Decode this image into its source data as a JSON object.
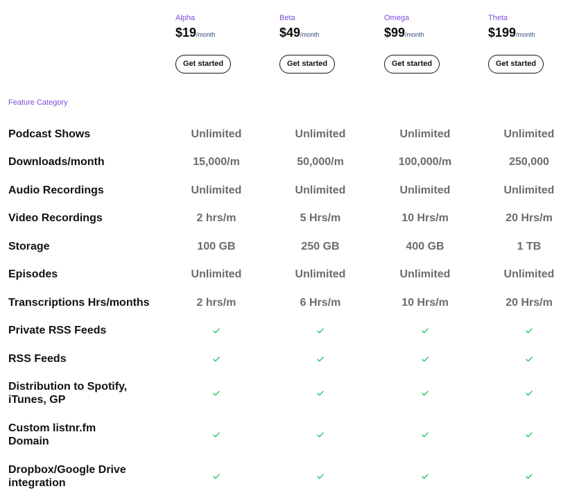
{
  "plans": [
    {
      "name": "Alpha",
      "price": "$19",
      "period": "/month",
      "cta": "Get started"
    },
    {
      "name": "Beta",
      "price": "$49",
      "period": "/month",
      "cta": "Get started"
    },
    {
      "name": "Omega",
      "price": "$99",
      "period": "/month",
      "cta": "Get started"
    },
    {
      "name": "Theta",
      "price": "$199",
      "period": "/month",
      "cta": "Get started"
    }
  ],
  "category_label": "Feature Category",
  "colors": {
    "accent": "#7c4ddb",
    "check": "#22c55e",
    "value_text": "#6b6b6b",
    "period_text": "#2e4a7a"
  },
  "features": [
    {
      "name": "Podcast Shows",
      "values": [
        "Unlimited",
        "Unlimited",
        "Unlimited",
        "Unlimited"
      ]
    },
    {
      "name": "Downloads/month",
      "values": [
        "15,000/m",
        "50,000/m",
        "100,000/m",
        "250,000"
      ]
    },
    {
      "name": "Audio Recordings",
      "values": [
        "Unlimited",
        "Unlimited",
        "Unlimited",
        "Unlimited"
      ]
    },
    {
      "name": "Video Recordings",
      "values": [
        "2 hrs/m",
        "5 Hrs/m",
        "10 Hrs/m",
        "20 Hrs/m"
      ]
    },
    {
      "name": "Storage",
      "values": [
        "100 GB",
        "250 GB",
        "400 GB",
        "1 TB"
      ]
    },
    {
      "name": "Episodes",
      "values": [
        "Unlimited",
        "Unlimited",
        "Unlimited",
        "Unlimited"
      ]
    },
    {
      "name": "Transcriptions Hrs/months",
      "values": [
        "2 hrs/m",
        "6 Hrs/m",
        "10 Hrs/m",
        "20 Hrs/m"
      ]
    },
    {
      "name": "Private RSS Feeds",
      "values": [
        "check-icon",
        "check-icon",
        "check-icon",
        "check-icon"
      ]
    },
    {
      "name": "RSS Feeds",
      "values": [
        "check-icon",
        "check-icon",
        "check-icon",
        "check-icon"
      ]
    },
    {
      "name_lines": [
        "Distribution to Spotify,",
        "iTunes, GP"
      ],
      "values": [
        "check-icon",
        "check-icon",
        "check-icon",
        "check-icon"
      ]
    },
    {
      "name_lines": [
        "Custom listnr.fm",
        "Domain"
      ],
      "values": [
        "check-icon",
        "check-icon",
        "check-icon",
        "check-icon"
      ]
    },
    {
      "name_lines": [
        "Dropbox/Google Drive",
        "integration"
      ],
      "values": [
        "check-icon",
        "check-icon",
        "check-icon",
        "check-icon"
      ]
    }
  ]
}
